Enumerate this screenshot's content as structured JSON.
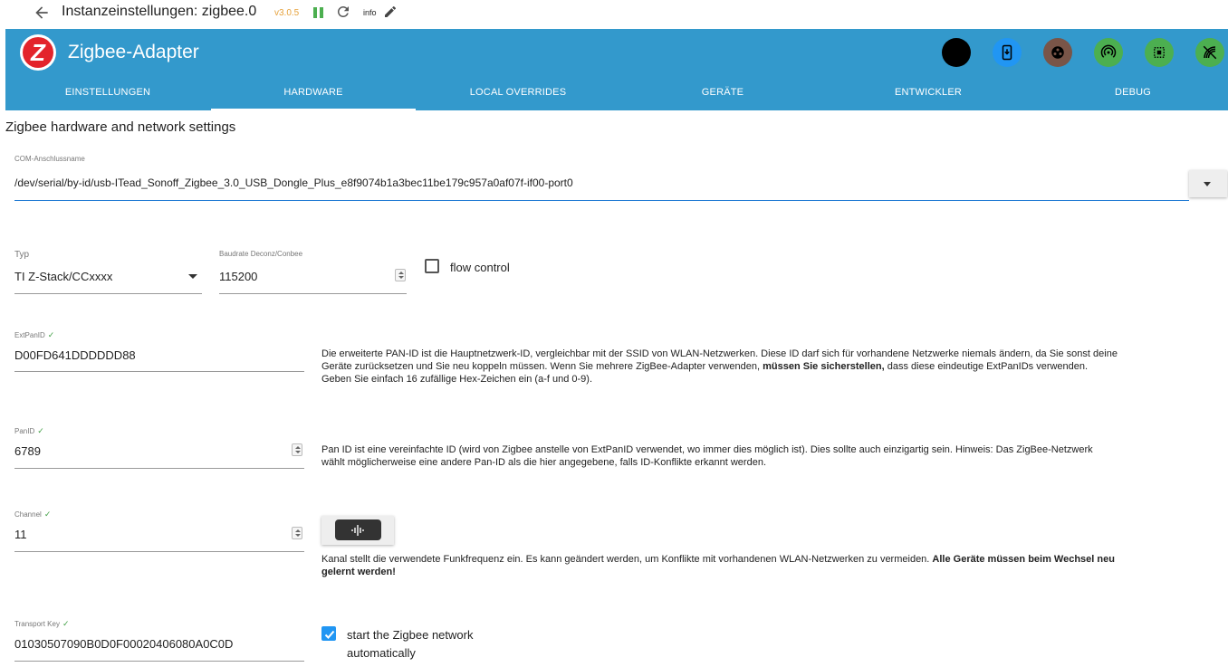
{
  "topbar": {
    "title": "Instanzeinstellungen: zigbee.0",
    "version": "v3.0.5",
    "info_label": "info"
  },
  "app": {
    "title": "Zigbee-Adapter",
    "action_icons": [
      {
        "name": "black-circle-icon",
        "color": "#000000"
      },
      {
        "name": "download-device-icon",
        "color": "#2196f3"
      },
      {
        "name": "group-icon",
        "color": "#795548"
      },
      {
        "name": "broadcast-icon",
        "color": "#4caf50"
      },
      {
        "name": "memory-chip-icon",
        "color": "#4caf50"
      },
      {
        "name": "signal-off-icon",
        "color": "#4caf50"
      }
    ]
  },
  "tabs": [
    {
      "label": "EINSTELLUNGEN",
      "active": false
    },
    {
      "label": "HARDWARE",
      "active": true
    },
    {
      "label": "LOCAL OVERRIDES",
      "active": false
    },
    {
      "label": "GERÄTE",
      "active": false
    },
    {
      "label": "ENTWICKLER",
      "active": false
    },
    {
      "label": "DEBUG",
      "active": false
    }
  ],
  "form": {
    "section_title": "Zigbee hardware and network settings",
    "com": {
      "label": "COM-Anschlussname",
      "value": "/dev/serial/by-id/usb-ITead_Sonoff_Zigbee_3.0_USB_Dongle_Plus_e8f9074b1a3bec11be179c957a0af07f-if00-port0"
    },
    "typ": {
      "label": "Typ",
      "value": "TI Z-Stack/CCxxxx"
    },
    "baudrate": {
      "label": "Baudrate Deconz/Conbee",
      "value": "115200"
    },
    "flow_control": {
      "label": "flow control",
      "checked": false
    },
    "extpanid": {
      "label": "ExtPanID",
      "value": "D00FD641DDDDDD88",
      "desc_1": "Die erweiterte PAN-ID ist die Hauptnetzwerk-ID, vergleichbar mit der SSID von WLAN-Netzwerken. Diese ID darf sich für vorhandene Netzwerke niemals ändern, da Sie sonst deine Geräte zurücksetzen und Sie neu koppeln müssen. Wenn Sie mehrere ZigBee-Adapter verwenden, ",
      "desc_bold": "müssen Sie sicherstellen,",
      "desc_2": " dass diese eindeutige ExtPanIDs verwenden. Geben Sie einfach 16 zufällige Hex-Zeichen ein (a-f und 0-9)."
    },
    "panid": {
      "label": "PanID",
      "value": "6789",
      "desc": "Pan ID ist eine vereinfachte ID (wird von Zigbee anstelle von ExtPanID verwendet, wo immer dies möglich ist). Dies sollte auch einzigartig sein. Hinweis: Das ZigBee-Netzwerk wählt möglicherweise eine andere Pan-ID als die hier angegebene, falls ID-Konflikte erkannt werden."
    },
    "channel": {
      "label": "Channel",
      "value": "11",
      "desc_1": "Kanal stellt die verwendete Funkfrequenz ein. Es kann geändert werden, um Konflikte mit vorhandenen WLAN-Netzwerken zu vermeiden. ",
      "desc_bold": "Alle Geräte müssen beim Wechsel neu gelernt werden!"
    },
    "transport_key": {
      "label": "Transport Key",
      "value": "01030507090B0D0F00020406080A0C0D"
    },
    "autostart": {
      "label_1": "start the Zigbee network",
      "label_2": "automatically",
      "checked": true
    }
  }
}
